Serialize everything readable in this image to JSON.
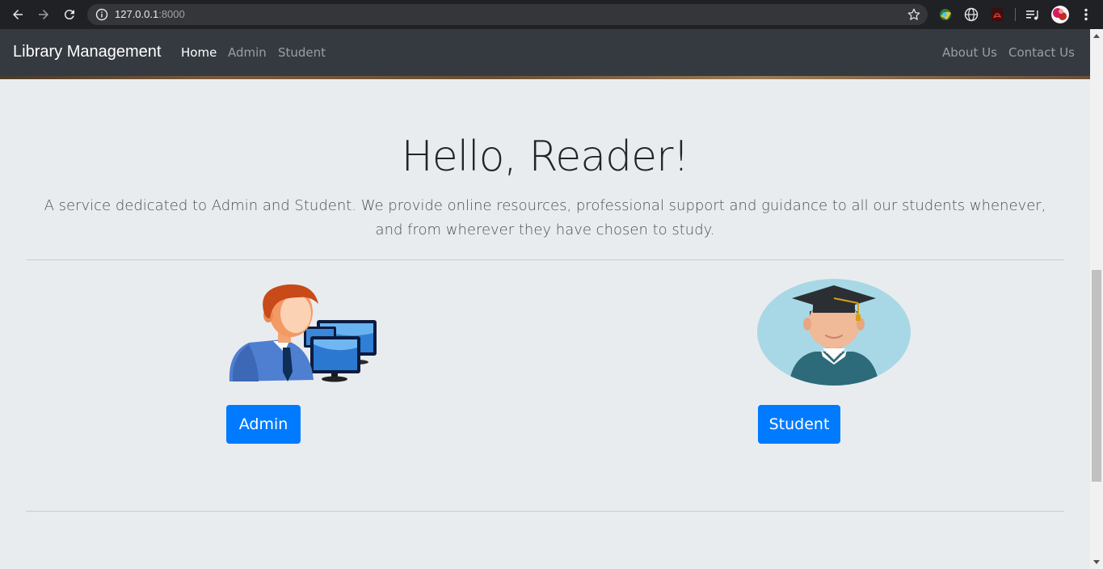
{
  "browser": {
    "url_host": "127.0.0.1",
    "url_port": ":8000",
    "icons": [
      "back-icon",
      "forward-icon",
      "reload-icon",
      "info-icon",
      "star-icon",
      "extension-icon",
      "globe-icon",
      "pdf-icon",
      "playlist-icon",
      "profile-avatar",
      "menu-icon"
    ]
  },
  "navbar": {
    "brand": "Library Management",
    "links": [
      "Home",
      "Admin",
      "Student"
    ],
    "active": "Home",
    "right_links": [
      "About Us",
      "Contact Us"
    ]
  },
  "hero": {
    "title": "Hello, Reader!",
    "lead": "A service dedicated to Admin and Student. We provide online resources, professional support and guidance to all our students whenever, and from wherever they have chosen to study."
  },
  "cards": {
    "admin": {
      "button": "Admin",
      "image": "admin-with-computers"
    },
    "student": {
      "button": "Student",
      "image": "graduate-student-avatar"
    }
  },
  "colors": {
    "navbar": "#343a40",
    "page": "#e9ecef",
    "primary": "#007bff"
  }
}
